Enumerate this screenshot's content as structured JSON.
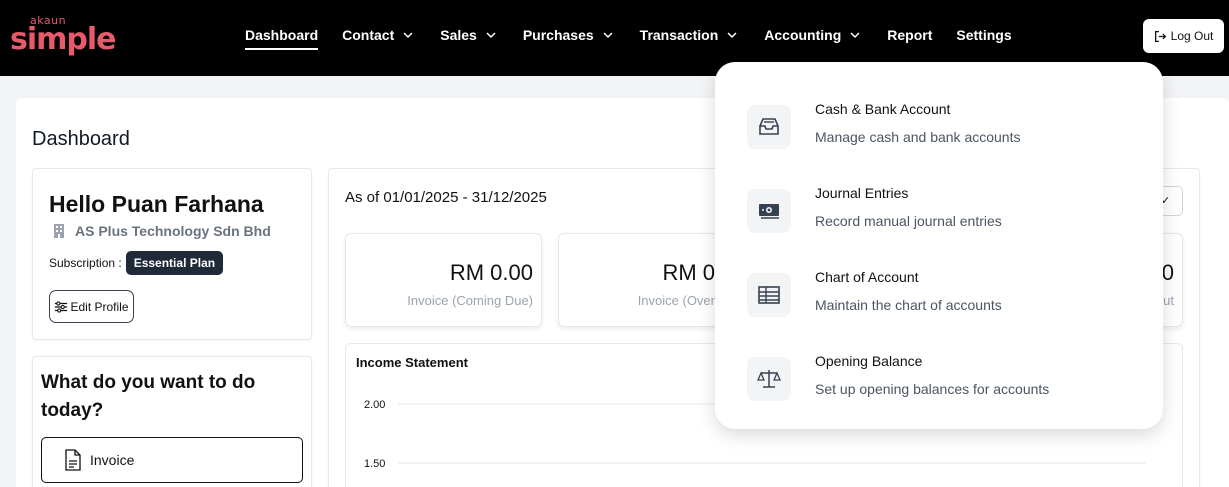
{
  "logo": {
    "small": "akaun",
    "big": "simple"
  },
  "nav": {
    "items": [
      {
        "label": "Dashboard",
        "active": true,
        "dropdown": false
      },
      {
        "label": "Contact",
        "active": false,
        "dropdown": true
      },
      {
        "label": "Sales",
        "active": false,
        "dropdown": true
      },
      {
        "label": "Purchases",
        "active": false,
        "dropdown": true
      },
      {
        "label": "Transaction",
        "active": false,
        "dropdown": true
      },
      {
        "label": "Accounting",
        "active": false,
        "dropdown": true
      },
      {
        "label": "Report",
        "active": false,
        "dropdown": false
      },
      {
        "label": "Settings",
        "active": false,
        "dropdown": false
      }
    ],
    "logout_label": "Log Out"
  },
  "page": {
    "title": "Dashboard"
  },
  "profile": {
    "greeting": "Hello Puan Farhana",
    "company": "AS Plus Technology Sdn Bhd",
    "subscription_label": "Subscription :",
    "plan": "Essential Plan",
    "edit_label": "Edit Profile"
  },
  "todo": {
    "title": "What do you want to do today?",
    "invoice_label": "Invoice"
  },
  "dashboard": {
    "as_of": "As of 01/01/2025 - 31/12/2025",
    "stats": [
      {
        "value": "RM 0.00",
        "label": "Invoice (Coming Due)"
      },
      {
        "value": "RM 0",
        "label": "Invoice (Over"
      },
      {
        "value": "0",
        "label": "ut"
      }
    ]
  },
  "income_statement": {
    "title": "Income Statement",
    "y_ticks": [
      "2.00",
      "1.50"
    ]
  },
  "accounting_menu": {
    "items": [
      {
        "title": "Cash & Bank Account",
        "description": "Manage cash and bank accounts",
        "icon": "inbox-tray-icon"
      },
      {
        "title": "Journal Entries",
        "description": "Record manual journal entries",
        "icon": "money-note-icon"
      },
      {
        "title": "Chart of Account",
        "description": "Maintain the chart of accounts",
        "icon": "table-icon"
      },
      {
        "title": "Opening Balance",
        "description": "Set up opening balances for accounts",
        "icon": "scale-icon"
      }
    ]
  },
  "colors": {
    "brand": "#e85a6a",
    "badge": "#1f2937"
  }
}
